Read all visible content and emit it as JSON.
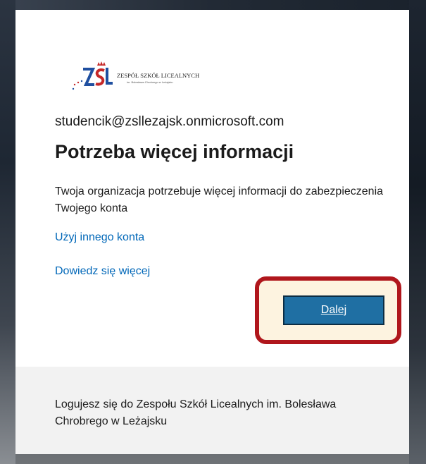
{
  "org_logo": {
    "name": "ZESPÓŁ SZKÓŁ LICEALNYCH",
    "subtitle": "im. Bolesława Chrobrego w Leżajsku",
    "monogram": "ZSL",
    "colors": {
      "red": "#c62828",
      "blue": "#1f4fa0"
    }
  },
  "account": {
    "email": "studencik@zsllezajsk.onmicrosoft.com"
  },
  "main": {
    "title": "Potrzeba więcej informacji",
    "description": "Twoja organizacja potrzebuje więcej informacji do zabezpieczenia Twojego konta",
    "use_other_account_link": "Użyj innego konta",
    "learn_more_link": "Dowiedz się więcej",
    "next_button": "Dalej"
  },
  "footer": {
    "text": "Logujesz się do Zespołu Szkół Licealnych im. Bolesława Chrobrego w Leżajsku"
  },
  "colors": {
    "link": "#0067b8",
    "button": "#1f6fa3",
    "highlight_border": "#b0161c",
    "footer_bg": "#f2f2f2"
  }
}
